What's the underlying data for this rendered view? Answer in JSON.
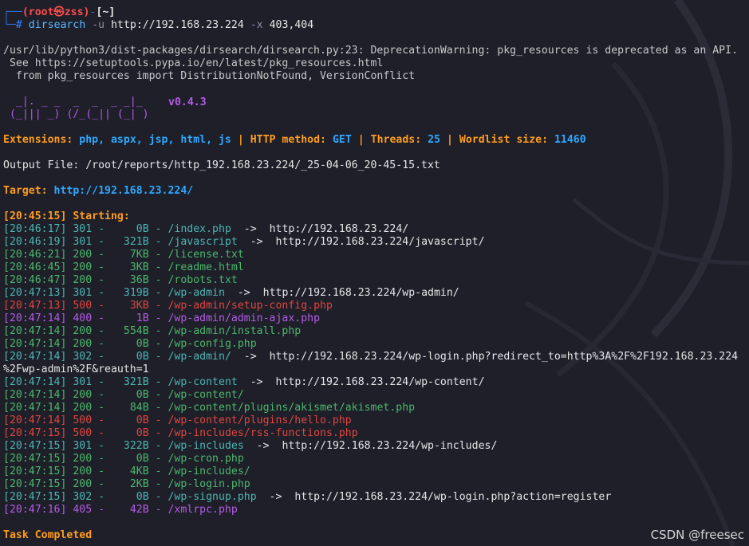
{
  "prompt": {
    "user_host": "(root㉿zss)",
    "dash": "-",
    "cwd": "[~]",
    "hash": "#",
    "command": "dirsearch",
    "args_u": "-u",
    "url": "http://192.168.23.224",
    "args_x": "-x",
    "exclude": "403,404"
  },
  "warning": [
    "/usr/lib/python3/dist-packages/dirsearch/dirsearch.py:23: DeprecationWarning: pkg_resources is deprecated as an API.",
    " See https://setuptools.pypa.io/en/latest/pkg_resources.html",
    "  from pkg_resources import DistributionNotFound, VersionConflict"
  ],
  "logo": {
    "line1": "  _|. _ _  _  _  _ _|_ ",
    "line2": " (_||| _) (/_(_|| (_| )",
    "version": "v0.4.3"
  },
  "config": {
    "ext_label": "Extensions:",
    "ext_value": "php, aspx, jsp, html, js",
    "sep": "|",
    "method_label": "HTTP method:",
    "method_value": "GET",
    "threads_label": "Threads:",
    "threads_value": "25",
    "wordlist_label": "Wordlist size:",
    "wordlist_value": "11460"
  },
  "output_file": "Output File: /root/reports/http_192.168.23.224/_25-04-06_20-45-15.txt",
  "target": {
    "label": "Target:",
    "url": "http://192.168.23.224/"
  },
  "starting": "[20:45:15] Starting:",
  "results": [
    {
      "time": "[20:46:17]",
      "status": "301",
      "size": "   0B",
      "path": "/index.php",
      "redirect": "http://192.168.23.224/",
      "color": "teal"
    },
    {
      "time": "[20:46:19]",
      "status": "301",
      "size": " 321B",
      "path": "/javascript",
      "redirect": "http://192.168.23.224/javascript/",
      "color": "teal"
    },
    {
      "time": "[20:46:21]",
      "status": "200",
      "size": "  7KB",
      "path": "/license.txt",
      "redirect": "",
      "color": "green"
    },
    {
      "time": "[20:46:45]",
      "status": "200",
      "size": "  3KB",
      "path": "/readme.html",
      "redirect": "",
      "color": "green"
    },
    {
      "time": "[20:46:47]",
      "status": "200",
      "size": "  36B",
      "path": "/robots.txt",
      "redirect": "",
      "color": "green"
    },
    {
      "time": "[20:47:13]",
      "status": "301",
      "size": " 319B",
      "path": "/wp-admin",
      "redirect": "http://192.168.23.224/wp-admin/",
      "color": "teal"
    },
    {
      "time": "[20:47:13]",
      "status": "500",
      "size": "  3KB",
      "path": "/wp-admin/setup-config.php",
      "redirect": "",
      "color": "red"
    },
    {
      "time": "[20:47:14]",
      "status": "400",
      "size": "   1B",
      "path": "/wp-admin/admin-ajax.php",
      "redirect": "",
      "color": "purple"
    },
    {
      "time": "[20:47:14]",
      "status": "200",
      "size": " 554B",
      "path": "/wp-admin/install.php",
      "redirect": "",
      "color": "green"
    },
    {
      "time": "[20:47:14]",
      "status": "200",
      "size": "   0B",
      "path": "/wp-config.php",
      "redirect": "",
      "color": "green"
    },
    {
      "time": "[20:47:14]",
      "status": "302",
      "size": "   0B",
      "path": "/wp-admin/",
      "redirect": "http://192.168.23.224/wp-login.php?redirect_to=http%3A%2F%2F192.168.23.224",
      "color": "teal"
    },
    {
      "time": "",
      "status": "",
      "size": "",
      "path": "",
      "redirect": "%2Fwp-admin%2F&reauth=1",
      "color": "wrap"
    },
    {
      "time": "[20:47:14]",
      "status": "301",
      "size": " 321B",
      "path": "/wp-content",
      "redirect": "http://192.168.23.224/wp-content/",
      "color": "teal"
    },
    {
      "time": "[20:47:14]",
      "status": "200",
      "size": "   0B",
      "path": "/wp-content/",
      "redirect": "",
      "color": "green"
    },
    {
      "time": "[20:47:14]",
      "status": "200",
      "size": "  84B",
      "path": "/wp-content/plugins/akismet/akismet.php",
      "redirect": "",
      "color": "green"
    },
    {
      "time": "[20:47:14]",
      "status": "500",
      "size": "   0B",
      "path": "/wp-content/plugins/hello.php",
      "redirect": "",
      "color": "red"
    },
    {
      "time": "[20:47:15]",
      "status": "500",
      "size": "   0B",
      "path": "/wp-includes/rss-functions.php",
      "redirect": "",
      "color": "red"
    },
    {
      "time": "[20:47:15]",
      "status": "301",
      "size": " 322B",
      "path": "/wp-includes",
      "redirect": "http://192.168.23.224/wp-includes/",
      "color": "teal"
    },
    {
      "time": "[20:47:15]",
      "status": "200",
      "size": "   0B",
      "path": "/wp-cron.php",
      "redirect": "",
      "color": "green"
    },
    {
      "time": "[20:47:15]",
      "status": "200",
      "size": "  4KB",
      "path": "/wp-includes/",
      "redirect": "",
      "color": "green"
    },
    {
      "time": "[20:47:15]",
      "status": "200",
      "size": "  2KB",
      "path": "/wp-login.php",
      "redirect": "",
      "color": "green"
    },
    {
      "time": "[20:47:15]",
      "status": "302",
      "size": "   0B",
      "path": "/wp-signup.php",
      "redirect": "http://192.168.23.224/wp-login.php?action=register",
      "color": "teal"
    },
    {
      "time": "[20:47:16]",
      "status": "405",
      "size": "  42B",
      "path": "/xmlrpc.php",
      "redirect": "",
      "color": "purple"
    }
  ],
  "arrow": "->",
  "task_completed": "Task Completed",
  "watermark": "CSDN @freesec"
}
